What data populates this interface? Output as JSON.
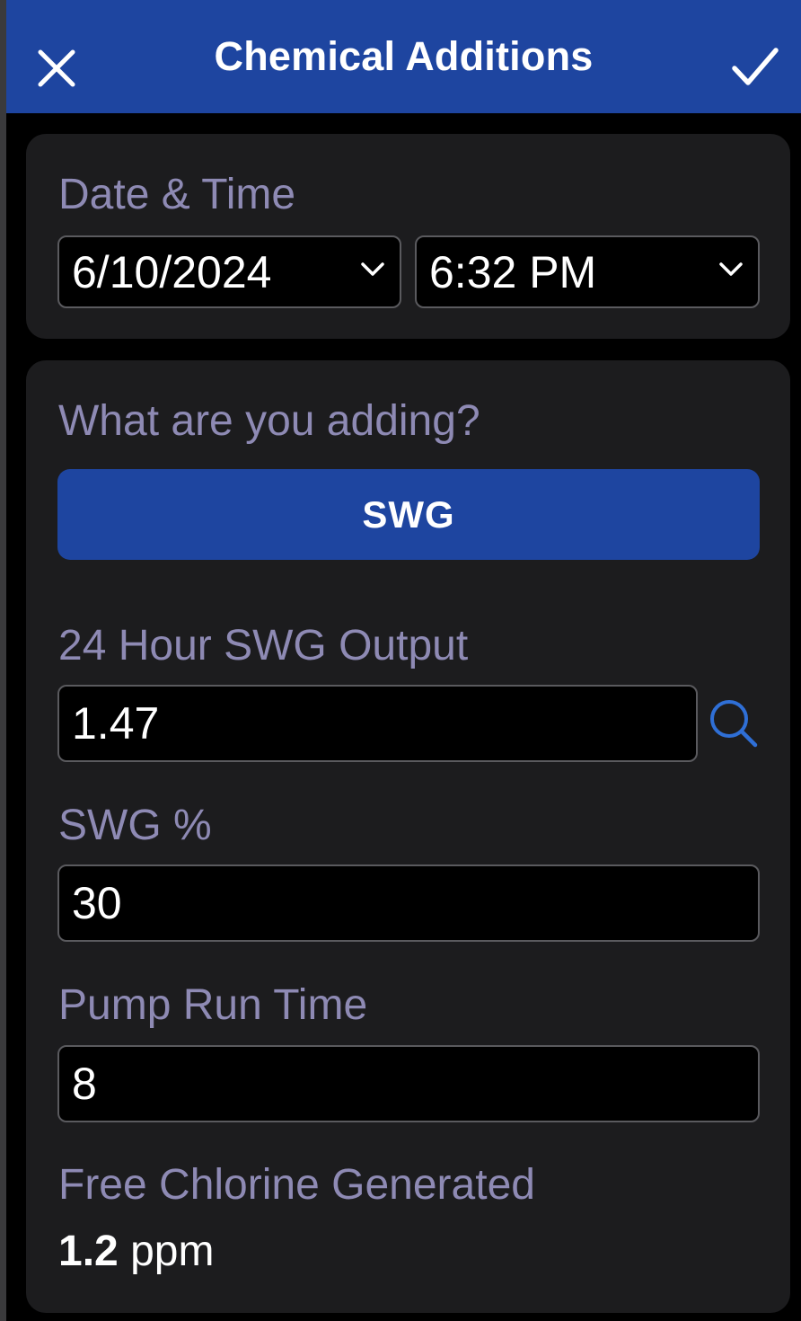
{
  "header": {
    "title": "Chemical Additions",
    "color": "#1e45a0"
  },
  "date_time": {
    "label": "Date & Time",
    "date": "6/10/2024",
    "time": "6:32 PM"
  },
  "addition": {
    "label": "What are you adding?",
    "selected_type": "SWG",
    "output": {
      "label": "24 Hour SWG Output",
      "value": "1.47"
    },
    "percent": {
      "label": "SWG %",
      "value": "30"
    },
    "pump_run_time": {
      "label": "Pump Run Time",
      "value": "8"
    },
    "result": {
      "label": "Free Chlorine Generated",
      "value": "1.2",
      "unit": "ppm"
    }
  },
  "icons": {
    "close": "close-icon",
    "confirm": "checkmark-icon",
    "search": "search-icon",
    "chevron": "chevron-down-icon"
  },
  "colors": {
    "accent": "#1e45a0",
    "card": "#1c1c1e",
    "label": "#8e8ab4",
    "search_icon": "#2f6fd6"
  }
}
